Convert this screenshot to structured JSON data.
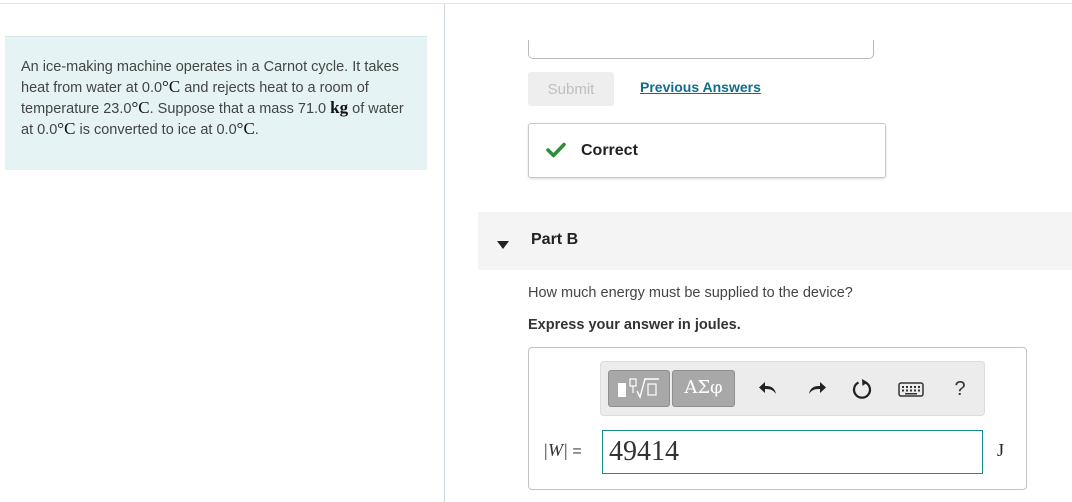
{
  "problem": {
    "t1": "An ice-making machine operates in a Carnot cycle. It takes heat from water at 0.0",
    "deg1": "°",
    "unit_c1": "C",
    "t2": " and rejects heat to a room of temperature 23.0",
    "deg2": "°",
    "unit_c2": "C",
    "t3": ". Suppose that a mass 71.0 ",
    "unit_kg": "kg",
    "t4": " of water at 0.0",
    "deg3": "°",
    "unit_c3": "C",
    "t5": " is converted to ice at 0.0",
    "deg4": "°",
    "unit_c4": "C",
    "t6": "."
  },
  "part_a": {
    "submit_label": "Submit",
    "previous_answers_label": "Previous Answers",
    "result_label": "Correct",
    "result_color": "#2e8b3a"
  },
  "part_b": {
    "title": "Part B",
    "question": "How much energy must be supplied to the device?",
    "instruction": "Express your answer in joules.",
    "toolbar": {
      "greek_label": "ΑΣφ",
      "icons": [
        "templates-icon",
        "undo-icon",
        "redo-icon",
        "reset-icon",
        "keyboard-icon",
        "help-icon"
      ],
      "help_label": "?"
    },
    "variable_label": "|W|",
    "equals": "=",
    "answer_value": "49414",
    "unit": "J"
  }
}
